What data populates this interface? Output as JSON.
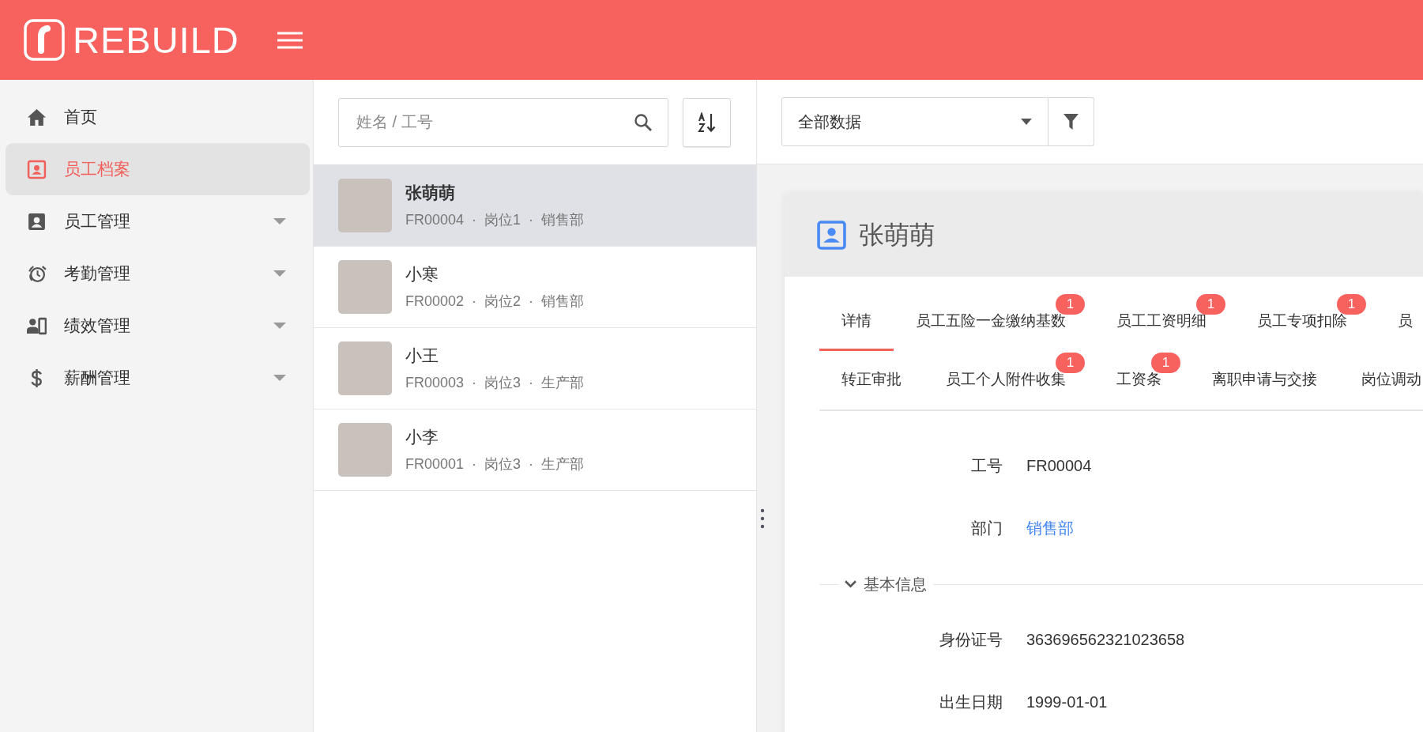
{
  "header": {
    "logo_text": "REBUILD"
  },
  "sidebar": {
    "items": [
      {
        "label": "首页",
        "kind": "home",
        "selected": false,
        "expandable": false
      },
      {
        "label": "员工档案",
        "kind": "contact",
        "selected": true,
        "expandable": false
      },
      {
        "label": "员工管理",
        "kind": "badge",
        "selected": false,
        "expandable": true
      },
      {
        "label": "考勤管理",
        "kind": "alarm",
        "selected": false,
        "expandable": true
      },
      {
        "label": "绩效管理",
        "kind": "people",
        "selected": false,
        "expandable": true
      },
      {
        "label": "薪酬管理",
        "kind": "dollar",
        "selected": false,
        "expandable": true
      }
    ]
  },
  "list": {
    "search": {
      "placeholder": "姓名 / 工号"
    },
    "items": [
      {
        "name": "张萌萌",
        "meta": "FR00004 · 岗位1 · 销售部",
        "selected": true
      },
      {
        "name": "小寒",
        "meta": "FR00002 · 岗位2 · 销售部",
        "selected": false
      },
      {
        "name": "小王",
        "meta": "FR00003 · 岗位3 · 生产部",
        "selected": false
      },
      {
        "name": "小李",
        "meta": "FR00001 · 岗位3 · 生产部",
        "selected": false
      }
    ]
  },
  "toolbar": {
    "filter": {
      "value": "全部数据"
    }
  },
  "detail": {
    "title": "张萌萌",
    "tab_rows": [
      [
        {
          "label": "详情",
          "selected": true
        },
        {
          "label": "员工五险一金缴纳基数",
          "selected": false,
          "badge": "1"
        },
        {
          "label": "员工工资明细",
          "selected": false,
          "badge": "1"
        },
        {
          "label": "员工专项扣除",
          "selected": false,
          "badge": "1"
        },
        {
          "label": "员",
          "selected": false
        }
      ],
      [
        {
          "label": "转正审批",
          "selected": false
        },
        {
          "label": "员工个人附件收集",
          "selected": false,
          "badge": "1"
        },
        {
          "label": "工资条",
          "selected": false,
          "badge": "1"
        },
        {
          "label": "离职申请与交接",
          "selected": false
        },
        {
          "label": "岗位调动",
          "selected": false
        }
      ]
    ],
    "fields": [
      {
        "label": "工号",
        "value": "FR00004",
        "kind": "text"
      },
      {
        "label": "部门",
        "value": "销售部",
        "kind": "link"
      }
    ],
    "sections": [
      {
        "title": "基本信息",
        "expanded": true,
        "fields": [
          {
            "label": "身份证号",
            "value": "363696562321023658",
            "kind": "text"
          },
          {
            "label": "出生日期",
            "value": "1999-01-01",
            "kind": "text"
          }
        ]
      }
    ]
  }
}
